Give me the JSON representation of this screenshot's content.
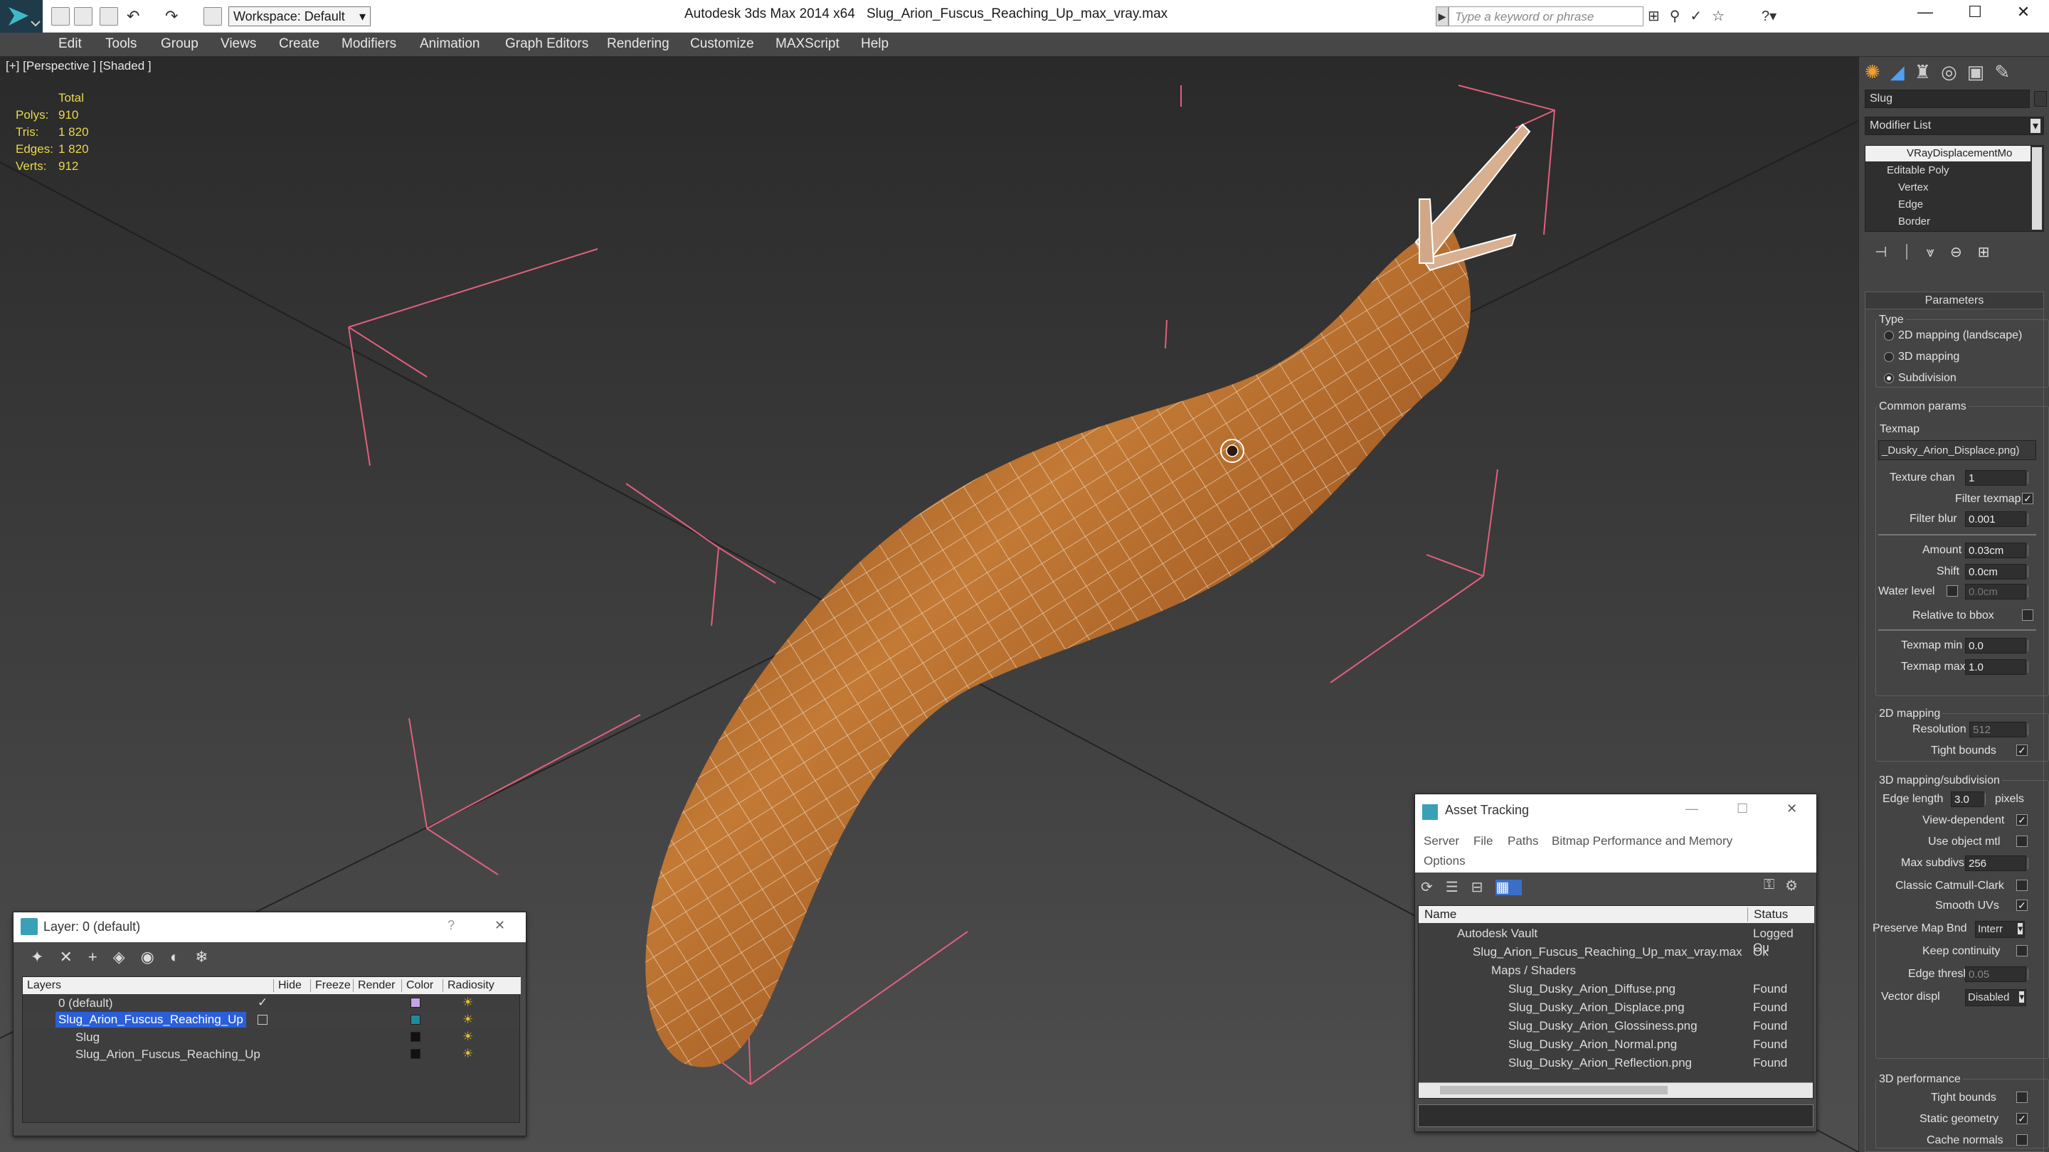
{
  "titlebar": {
    "app_title": "Autodesk 3ds Max  2014 x64",
    "file_name": "Slug_Arion_Fuscus_Reaching_Up_max_vray.max",
    "workspace": "Workspace: Default",
    "search_placeholder": "Type a keyword or phrase",
    "minimize": "—",
    "maximize": "☐",
    "close": "✕"
  },
  "menu": [
    "Edit",
    "Tools",
    "Group",
    "Views",
    "Create",
    "Modifiers",
    "Animation",
    "Graph Editors",
    "Rendering",
    "Customize",
    "MAXScript",
    "Help"
  ],
  "viewport": {
    "label": "[+] [Perspective ] [Shaded ]",
    "stats": {
      "header": "Total",
      "rows": [
        {
          "k": "Polys:",
          "v": "910"
        },
        {
          "k": "Tris:",
          "v": "1 820"
        },
        {
          "k": "Edges:",
          "v": "1 820"
        },
        {
          "k": "Verts:",
          "v": "912"
        }
      ]
    }
  },
  "layer_window": {
    "title": "Layer: 0 (default)",
    "help": "?",
    "close": "✕",
    "columns": [
      "Layers",
      "Hide",
      "Freeze",
      "Render",
      "Color",
      "Radiosity"
    ],
    "rows": [
      {
        "name": "0 (default)",
        "color": "#c7a4e6",
        "selected": false
      },
      {
        "name": "Slug_Arion_Fuscus_Reaching_Up",
        "color": "#1e8aa0",
        "selected": true
      },
      {
        "name": "Slug",
        "color": "#111111",
        "selected": false
      },
      {
        "name": "Slug_Arion_Fuscus_Reaching_Up",
        "color": "#111111",
        "selected": false
      }
    ]
  },
  "asset_window": {
    "title": "Asset Tracking",
    "menu": [
      "Server",
      "File",
      "Paths",
      "Bitmap Performance and Memory",
      "Options"
    ],
    "columns": [
      "Name",
      "Status"
    ],
    "rows": [
      {
        "name": "Autodesk Vault",
        "status": "Logged Ou"
      },
      {
        "name": "Slug_Arion_Fuscus_Reaching_Up_max_vray.max",
        "status": "Ok"
      },
      {
        "name": "Maps / Shaders",
        "status": ""
      },
      {
        "name": "Slug_Dusky_Arion_Diffuse.png",
        "status": "Found"
      },
      {
        "name": "Slug_Dusky_Arion_Displace.png",
        "status": "Found"
      },
      {
        "name": "Slug_Dusky_Arion_Glossiness.png",
        "status": "Found"
      },
      {
        "name": "Slug_Dusky_Arion_Normal.png",
        "status": "Found"
      },
      {
        "name": "Slug_Dusky_Arion_Reflection.png",
        "status": "Found"
      }
    ]
  },
  "command_panel": {
    "object_name": "Slug",
    "modifier_list": "Modifier List",
    "stack": [
      "VRayDisplacementMo",
      "Editable Poly",
      "Vertex",
      "Edge",
      "Border"
    ],
    "rollout_title": "Parameters",
    "type_label": "Type",
    "type_options": [
      "2D mapping (landscape)",
      "3D mapping",
      "Subdivision"
    ],
    "common_params": "Common params",
    "texmap_label": "Texmap",
    "texmap_value": "_Dusky_Arion_Displace.png)",
    "texture_chan_label": "Texture chan",
    "texture_chan": "1",
    "filter_texmap": "Filter texmap",
    "filter_blur_label": "Filter blur",
    "filter_blur": "0.001",
    "amount_label": "Amount",
    "amount": "0.03cm",
    "shift_label": "Shift",
    "shift": "0.0cm",
    "water_level_label": "Water level",
    "water_level": "0.0cm",
    "relative_bbox": "Relative to bbox",
    "texmap_min_label": "Texmap min",
    "texmap_min": "0.0",
    "texmap_max_label": "Texmap max",
    "texmap_max": "1.0",
    "section_2d": "2D mapping",
    "resolution_label": "Resolution",
    "resolution": "512",
    "tight_bounds": "Tight bounds",
    "section_3d": "3D mapping/subdivision",
    "edge_length_label": "Edge length",
    "edge_length": "3.0",
    "pixels": "pixels",
    "view_dependent": "View-dependent",
    "use_object_mtl": "Use object mtl",
    "max_subdivs_label": "Max subdivs",
    "max_subdivs": "256",
    "classic_catmull": "Classic Catmull-Clark",
    "smooth_uvs": "Smooth UVs",
    "preserve_map_label": "Preserve Map Bnd",
    "preserve_map": "Interr",
    "keep_continuity": "Keep continuity",
    "edge_thresh_label": "Edge thresh",
    "edge_thresh": "0.05",
    "vector_disp_label": "Vector displ",
    "vector_disp": "Disabled",
    "section_perf": "3D performance",
    "tight_bounds_perf": "Tight bounds",
    "static_geometry": "Static geometry",
    "cache_normals": "Cache normals"
  }
}
